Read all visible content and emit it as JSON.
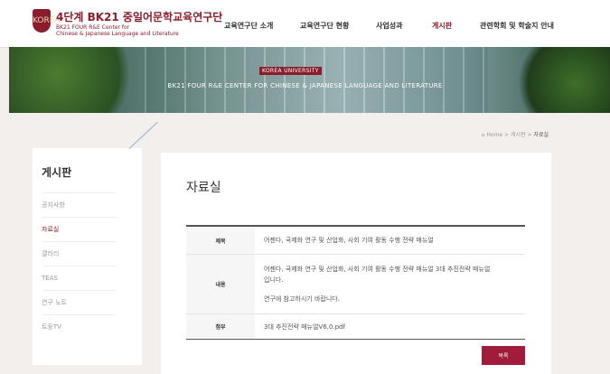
{
  "header": {
    "logo_text": "KOREA",
    "title": "4단계 BK21 중일어문학교육연구단",
    "subtitle_line1": "BK21 FOUR R&E Center for",
    "subtitle_line2": "Chinese & Japanese Language and Literature",
    "nav": [
      "교육연구단 소개",
      "교육연구단 현황",
      "사업성과",
      "게시판",
      "관련학회 및 학술지 안내"
    ]
  },
  "banner": {
    "badge": "KOREA UNIVERSITY",
    "title": "BK21 FOUR R&E CENTER FOR CHINESE & JAPANESE LANGUAGE AND LITERATURE"
  },
  "breadcrumb": {
    "home": "⌂ Home",
    "sep": ">",
    "level1": "게시판",
    "current": "자료실"
  },
  "sidebar": {
    "title": "게시판",
    "items": [
      "공지사항",
      "자료실",
      "갤러리",
      "TEAS",
      "연구 노트",
      "트둥TV"
    ],
    "active_index": 1
  },
  "main": {
    "page_title": "자료실",
    "rows": {
      "subject_label": "제목",
      "subject_value": "어젠다, 국제화 연구 및 산업화, 사회 기여 활동 수행 전략 매뉴얼",
      "content_label": "내용",
      "content_line1": "어젠다, 국제화 연구 및 산업화, 사회 기여 활동 수행 전략 매뉴얼 3대 추진전략 매뉴얼",
      "content_line2": "입니다.",
      "content_line3": "연구에 참고하시기 바랍니다.",
      "attach_label": "첨부",
      "attach_value": "3대 추진전략 매뉴얼V6.0.pdf"
    },
    "list_button": "목록"
  },
  "colors": {
    "brand": "#8b1c2c",
    "button": "#a01c3a",
    "background": "#f3efec"
  }
}
